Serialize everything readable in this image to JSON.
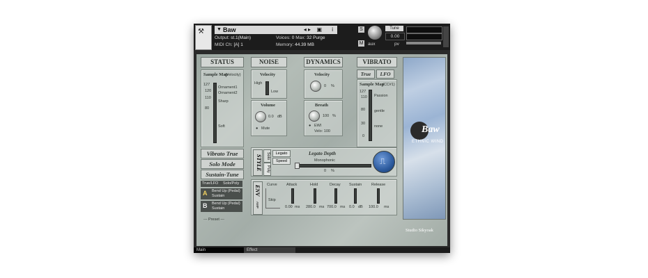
{
  "header": {
    "instrument_name": "Baw",
    "output_label": "Output:",
    "output_value": "st.1(Main)",
    "midi_label": "MIDI Ch:",
    "midi_value": "[A] 1",
    "voices_label": "Voices:",
    "voices_value": "0",
    "max_label": "Max:",
    "max_value": "32",
    "purge_label": "Purge",
    "memory_label": "Memory:",
    "memory_value": "44.39 MB",
    "tune_label": "Tune",
    "tune_value": "0.00",
    "s_label": "S",
    "m_label": "M",
    "aux_label": "aux",
    "pv_label": "pv",
    "nav_arrows": "◂ ▸",
    "camera_icon": "camera-icon",
    "info_icon": "i"
  },
  "status": {
    "title": "STATUS",
    "samplemap_label": "Sample Map",
    "samplemap_mode": "(Velocity)",
    "ticks": [
      "127",
      "120",
      "110",
      "80"
    ],
    "layers": [
      "Ornament1",
      "Ornament2",
      "Sharp",
      "Soft"
    ],
    "vibrato_btn": "Vibrato True",
    "solo_btn": "Solo Mode",
    "sustain_btn": "Sustain-Tune"
  },
  "noise": {
    "title": "NOISE",
    "velocity_label": "Velocity",
    "high_label": "High",
    "low_label": "Low",
    "volume_label": "Volume",
    "volume_value": "0.0",
    "volume_unit": "dB",
    "mute_label": "Mute"
  },
  "dynamics": {
    "title": "DYNAMICS",
    "velocity_label": "Velocity",
    "velocity_value": "0",
    "velocity_unit": "%",
    "breath_label": "Breath",
    "breath_value": "100",
    "breath_unit": "%",
    "ewi_label": "EWI",
    "velo_label": "Velo: 100"
  },
  "vibrato": {
    "title": "VIBRATO",
    "tab_true": "True",
    "tab_lfo": "LFO",
    "samplemap_label": "Sample Map",
    "samplemap_mode": "(CC#1)",
    "ticks": [
      "127",
      "110",
      "80",
      "30",
      "0"
    ],
    "layers": [
      "Passion",
      "gentle",
      "none"
    ]
  },
  "style": {
    "title": "STYLE",
    "solo_tab": "Solo",
    "poly_tab": "Poly",
    "legato_btn": "Legato",
    "speed_btn": "Speed",
    "legato_depth_label": "Legato Depth",
    "monophonic_label": "Monophonic",
    "depth_value": "0",
    "depth_unit": "%"
  },
  "env": {
    "title": "ENV",
    "sub": "AMP",
    "curve_label": "Curve",
    "skip_label": "Skip",
    "attack_label": "Attack",
    "attack_value": "0.00",
    "attack_unit": "ms",
    "hold_label": "Hold",
    "hold_value": "280.0",
    "hold_unit": "ms",
    "decay_label": "Decay",
    "decay_value": "700.0",
    "decay_unit": "ms",
    "sustain_label": "Sustain",
    "sustain_value": "0.0",
    "sustain_unit": "dB",
    "release_label": "Release",
    "release_value": "100.0",
    "release_unit": "ms"
  },
  "bottom_left": {
    "tab1": "True/LFO",
    "tab2": "Solo/Poly",
    "slot_a_letter": "A",
    "slot_a_line1": "Bend Up (Pedal)",
    "slot_a_line2": "Sustain",
    "slot_b_letter": "B",
    "slot_b_line1": "Bend Up (Pedal)",
    "slot_b_line2": "Sustain",
    "preset_label": "--- Preset ---"
  },
  "brand": {
    "logo_text": "Baw",
    "logo_sub": "ETHNIC WIND",
    "studio": "Studio Sikyoak"
  },
  "tabs": {
    "main": "Main",
    "effect": "Effect"
  }
}
